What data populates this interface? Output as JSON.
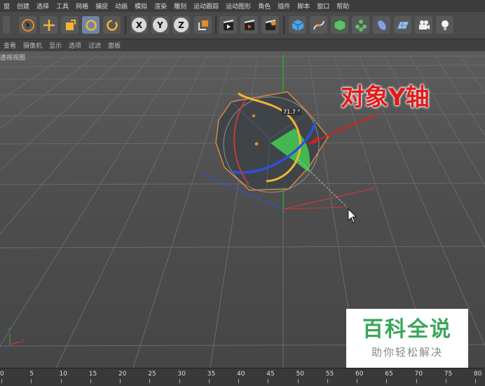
{
  "menu": [
    "窗",
    "创建",
    "选择",
    "工具",
    "网格",
    "捕捉",
    "动画",
    "模拟",
    "渲染",
    "雕刻",
    "运动跟踪",
    "运动图形",
    "角色",
    "插件",
    "脚本",
    "窗口",
    "帮助"
  ],
  "toolbar": {
    "x_label": "X",
    "y_label": "Y",
    "z_label": "Z"
  },
  "view_menu": [
    "查看",
    "摄像机",
    "显示",
    "选项",
    "过滤",
    "面板"
  ],
  "viewport": {
    "label": "透视视图",
    "annotation": "对象Y轴",
    "angle_readout": "71.7 °",
    "axis_y": "Y",
    "axis_x": "X"
  },
  "watermark": {
    "title": "百科全说",
    "subtitle": "助你轻松解决"
  },
  "timeline": {
    "ticks": [
      "0",
      "5",
      "10",
      "15",
      "20",
      "25",
      "30",
      "35",
      "40",
      "45",
      "50",
      "55",
      "60",
      "65",
      "70",
      "75",
      "80"
    ]
  },
  "colors": {
    "annotation": "#e21b1b",
    "axis_x": "#c83a3a",
    "axis_y": "#2fa82f",
    "axis_z": "#2e52d6",
    "watermark_green": "#3aa65a"
  }
}
